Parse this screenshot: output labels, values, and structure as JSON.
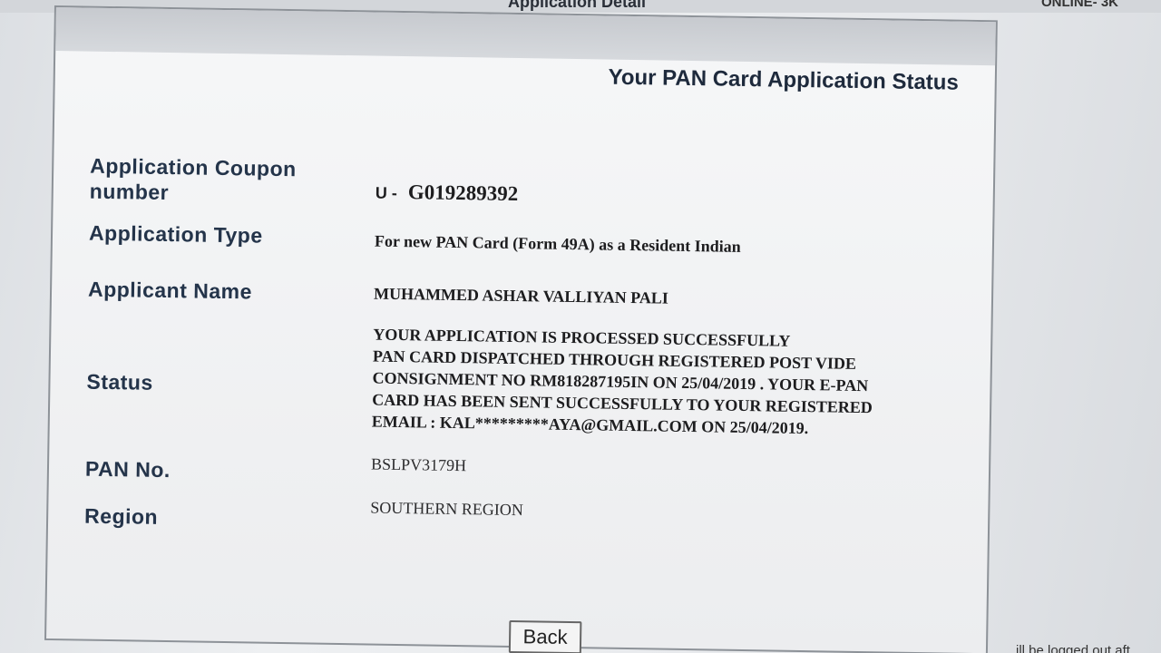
{
  "window": {
    "title": "Application Detail",
    "corner_text": "ONLINE- 3K",
    "corner_bottom_text": "ill be logged out aft"
  },
  "heading": "Your PAN Card Application Status",
  "fields": {
    "coupon": {
      "label": "Application Coupon number",
      "prefix": "U -",
      "value": "G019289392"
    },
    "type": {
      "label": "Application Type",
      "value": "For new PAN Card (Form 49A) as a Resident Indian"
    },
    "name": {
      "label": "Applicant Name",
      "value": "MUHAMMED ASHAR VALLIYAN PALI"
    },
    "status": {
      "label": "Status",
      "lines": [
        "YOUR APPLICATION IS PROCESSED SUCCESSFULLY",
        "PAN CARD DISPATCHED THROUGH REGISTERED POST VIDE",
        "CONSIGNMENT NO RM818287195IN ON 25/04/2019 . YOUR E-PAN",
        "CARD HAS BEEN SENT SUCCESSFULLY TO YOUR REGISTERED",
        "EMAIL : KAL*********AYA@GMAIL.COM ON 25/04/2019."
      ]
    },
    "pan": {
      "label": "PAN No.",
      "value": "BSLPV3179H"
    },
    "region": {
      "label": "Region",
      "value": "SOUTHERN REGION"
    }
  },
  "buttons": {
    "back": "Back"
  }
}
